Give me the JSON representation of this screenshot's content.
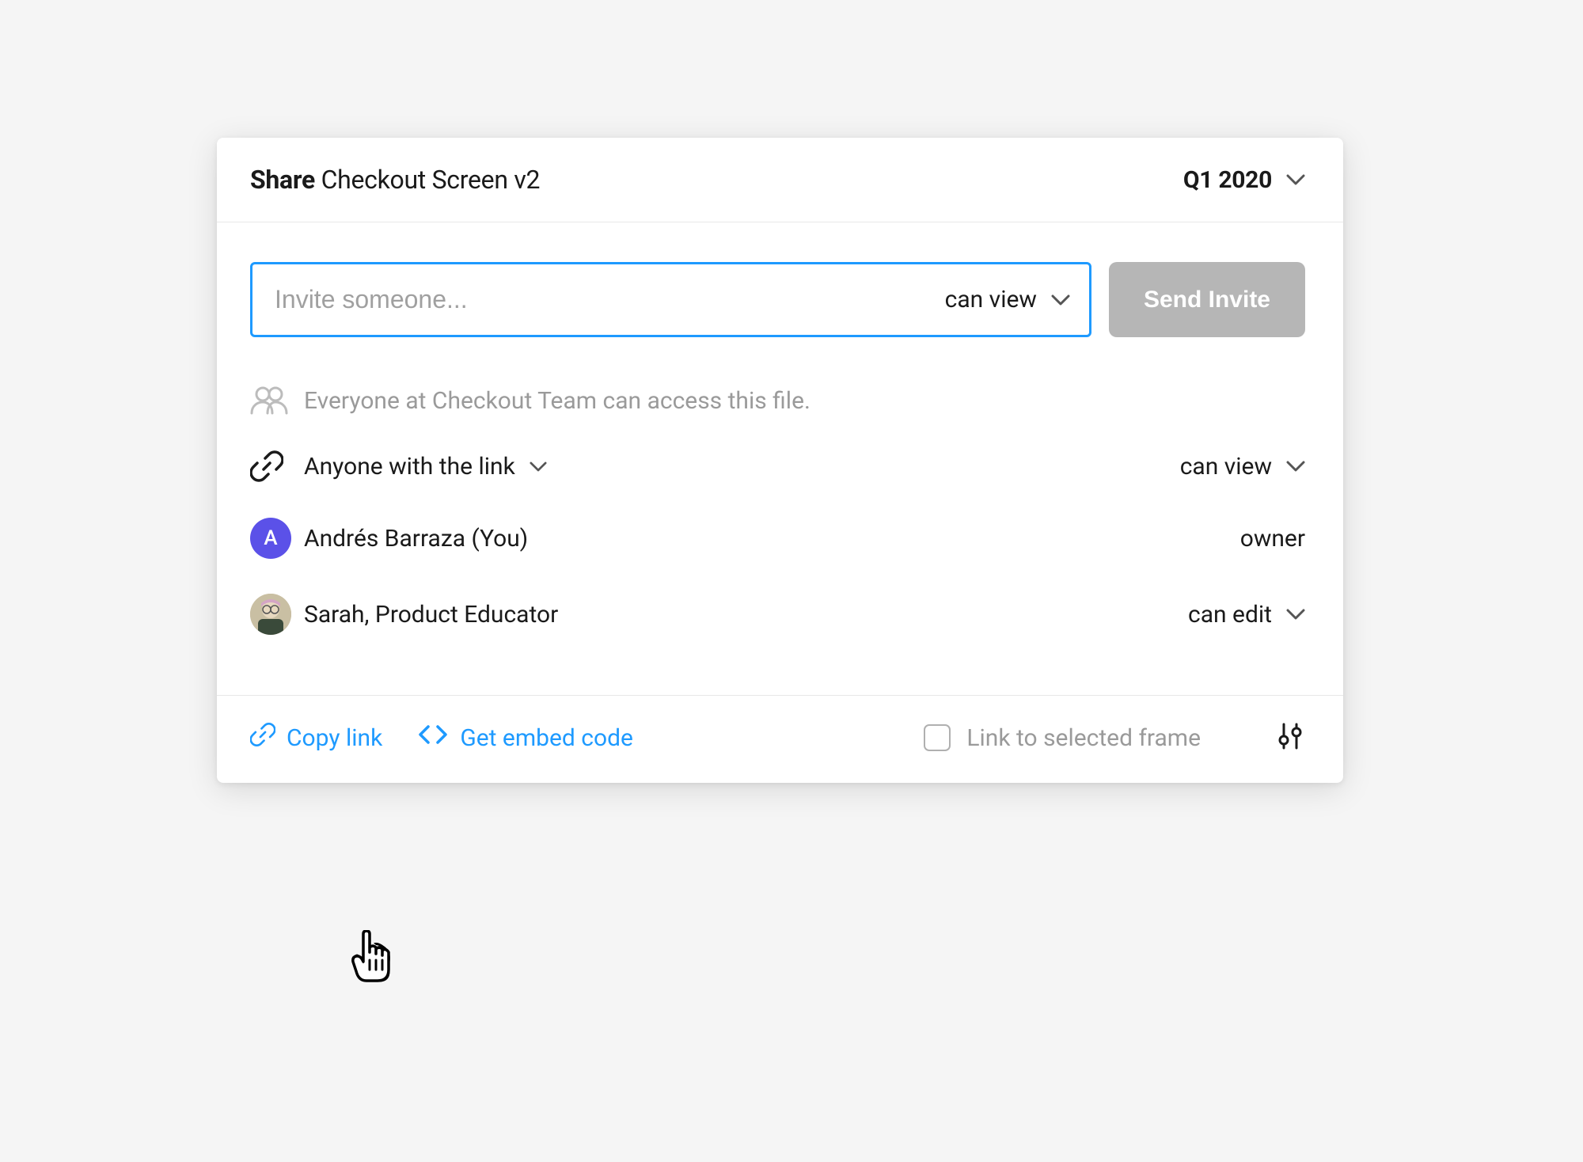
{
  "header": {
    "share_prefix": "Share",
    "file_name": "Checkout Screen v2",
    "project": "Q1 2020"
  },
  "invite": {
    "placeholder": "Invite someone...",
    "permission": "can view",
    "send_label": "Send Invite"
  },
  "access": {
    "team_notice": "Everyone at Checkout Team can access this file.",
    "link_label": "Anyone with the link",
    "link_permission": "can view",
    "members": [
      {
        "name": "Andrés Barraza (You)",
        "role": "owner",
        "avatar_letter": "A"
      },
      {
        "name": "Sarah, Product Educator",
        "role": "can edit"
      }
    ]
  },
  "footer": {
    "copy_link": "Copy link",
    "embed": "Get embed code",
    "link_frame": "Link to selected frame"
  },
  "colors": {
    "accent": "#1e9aff",
    "avatar_bg": "#5b51e8"
  }
}
